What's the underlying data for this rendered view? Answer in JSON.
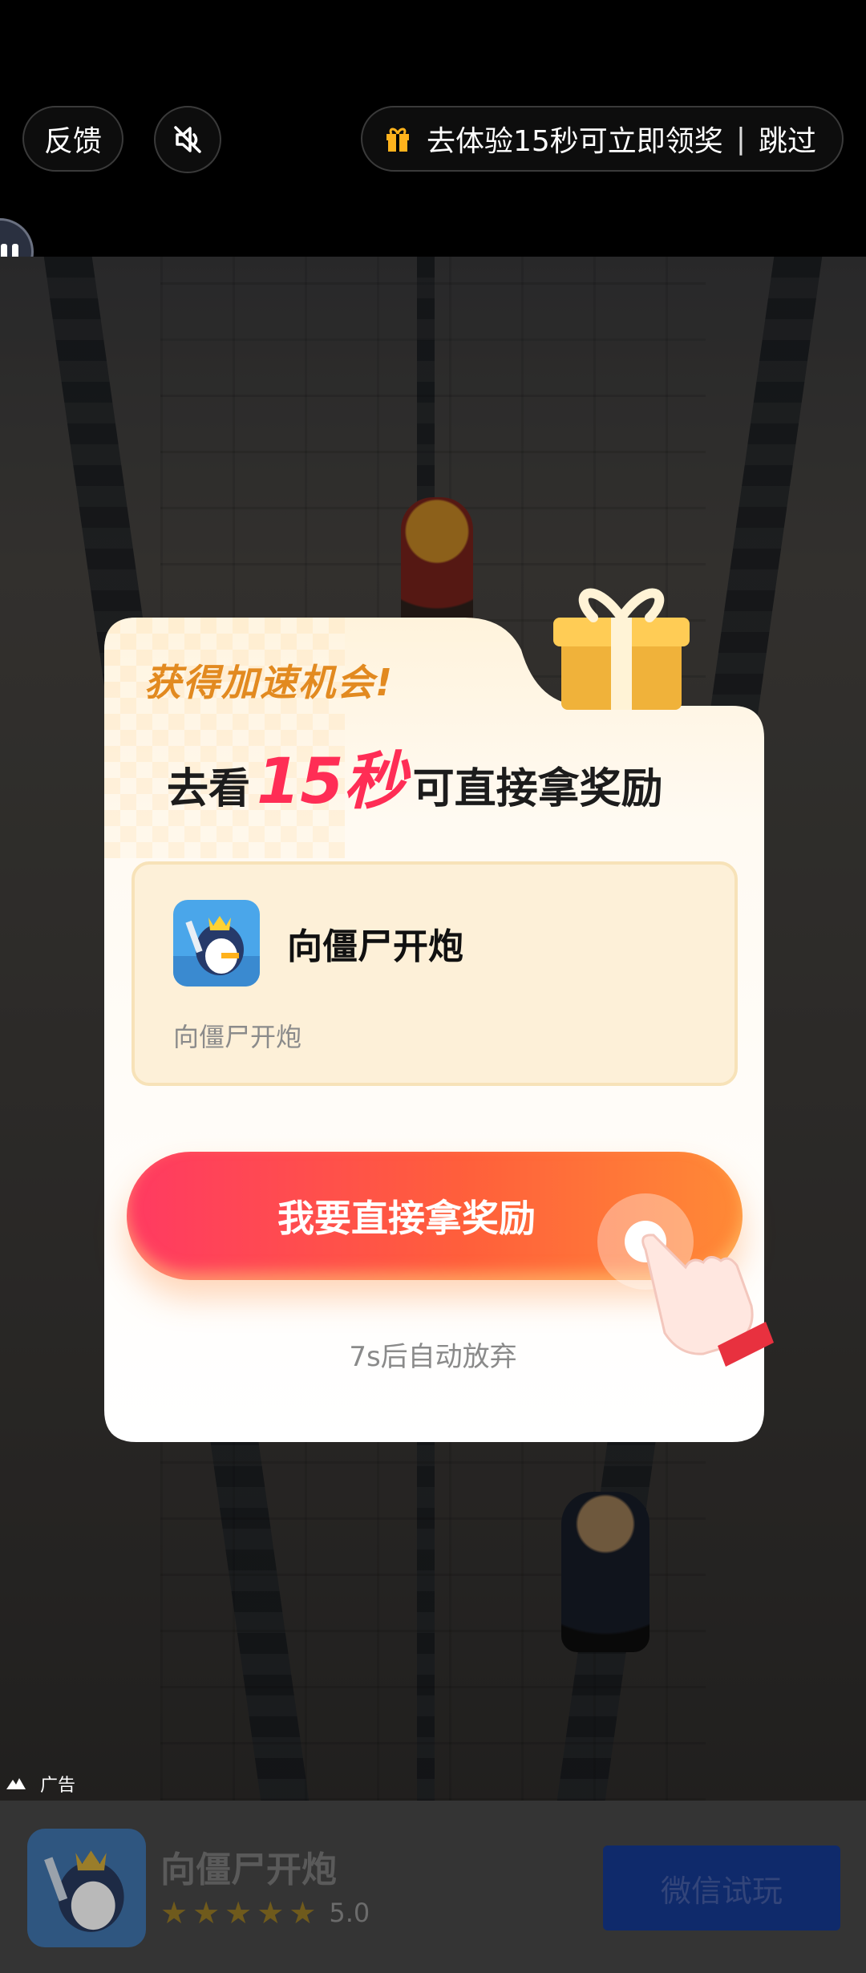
{
  "top_bar": {
    "feedback_label": "反馈",
    "mute_icon": "speaker-muted-icon",
    "skip_text": "去体验15秒可立即领奖",
    "skip_separator": "|",
    "skip_label": "跳过",
    "gift_icon": "gift-icon"
  },
  "popup": {
    "headline_1": "获得加速机会!",
    "headline_2_prefix": "去看",
    "headline_2_highlight": "15秒",
    "headline_2_suffix": "可直接拿奖励",
    "app_title": "向僵尸开炮",
    "app_subtitle": "向僵尸开炮",
    "cta_label": "我要直接拿奖励",
    "countdown": "7s后自动放弃"
  },
  "ad_tag": {
    "label": "广告"
  },
  "bottom_bar": {
    "app_name": "向僵尸开炮",
    "rating": "5.0",
    "stars": 5,
    "button_label": "微信试玩"
  },
  "colors": {
    "accent_pink": "#ff3a62",
    "accent_orange": "#ff8a36",
    "headline_orange": "#e28a20",
    "button_blue": "#0f2a6b"
  }
}
